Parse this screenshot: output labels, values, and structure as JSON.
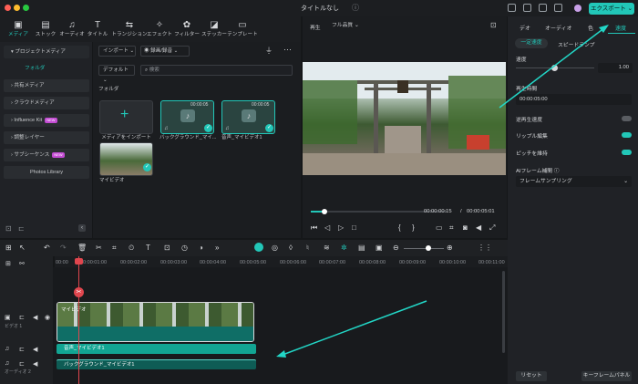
{
  "window": {
    "title": "タイトルなし"
  },
  "topbar": {
    "export_label": "エクスポート"
  },
  "toolbar": {
    "items": [
      {
        "label": "メディア",
        "icon": "media-icon"
      },
      {
        "label": "ストック",
        "icon": "stock-icon"
      },
      {
        "label": "オーディオ",
        "icon": "music-icon"
      },
      {
        "label": "タイトル",
        "icon": "title-icon"
      },
      {
        "label": "トランジション",
        "icon": "transition-icon"
      },
      {
        "label": "エフェクト",
        "icon": "effect-icon"
      },
      {
        "label": "フィルター",
        "icon": "filter-icon"
      },
      {
        "label": "ステッカー",
        "icon": "sticker-icon"
      },
      {
        "label": "テンプレート",
        "icon": "template-icon"
      }
    ]
  },
  "media_sidebar": {
    "items": [
      "プロジェクトメディア",
      "フォルダ",
      "共有メディア",
      "クラウドメディア",
      "Influence Kit",
      "調整レイヤー",
      "サブシーケンス",
      "Photos Library"
    ],
    "new_badge": "NEW"
  },
  "media": {
    "import_label": "インポート",
    "record_label": "録画/録音",
    "sort_label": "デフォルト",
    "search_placeholder": "検索",
    "folder_heading": "フォルダ",
    "items": [
      {
        "label": "メディアをインポート"
      },
      {
        "label": "バックグラウンド_マイ...",
        "duration": "00:00:05"
      },
      {
        "label": "音声_マイビデオ1",
        "duration": "00:00:05"
      },
      {
        "label": "マイビデオ"
      }
    ]
  },
  "player": {
    "label": "再生",
    "quality": "フル品質",
    "current_time": "00:00:00:15",
    "separator": "/",
    "total_time": "00:00:05:01"
  },
  "properties": {
    "tabs": [
      "デオ",
      "オーディオ",
      "色",
      "速度"
    ],
    "subtabs": [
      "一定速度",
      "スピードランプ"
    ],
    "speed_label": "速度",
    "speed_value": "1.00",
    "duration_label": "再生時間",
    "duration_value": "00:00:05:00",
    "reverse_label": "逆再生速度",
    "ripple_label": "リップル編集",
    "pitch_label": "ピッチを維持",
    "ai_label": "AIフレーム補間",
    "ai_value": "フレームサンプリング",
    "reset_label": "リセット",
    "keyframe_label": "キーフレームパネル"
  },
  "timeline": {
    "ticks": [
      "00:00",
      "00:00:01:00",
      "00:00:02:00",
      "00:00:03:00",
      "00:00:04:00",
      "00:00:05:00",
      "00:00:06:00",
      "00:00:07:00",
      "00:00:08:00",
      "00:00:09:00",
      "00:00:10:00",
      "00:00:11:00"
    ],
    "video_clip": "マイビデオ",
    "audio1_clip": "音声_マイビデオ1",
    "audio2_clip": "バックグラウンド_マイビデオ1",
    "track_video": "ビデオ 1",
    "track_audio2": "オーディオ 2"
  },
  "colors": {
    "accent": "#22c7b8",
    "annotation": "#22d6c6"
  }
}
